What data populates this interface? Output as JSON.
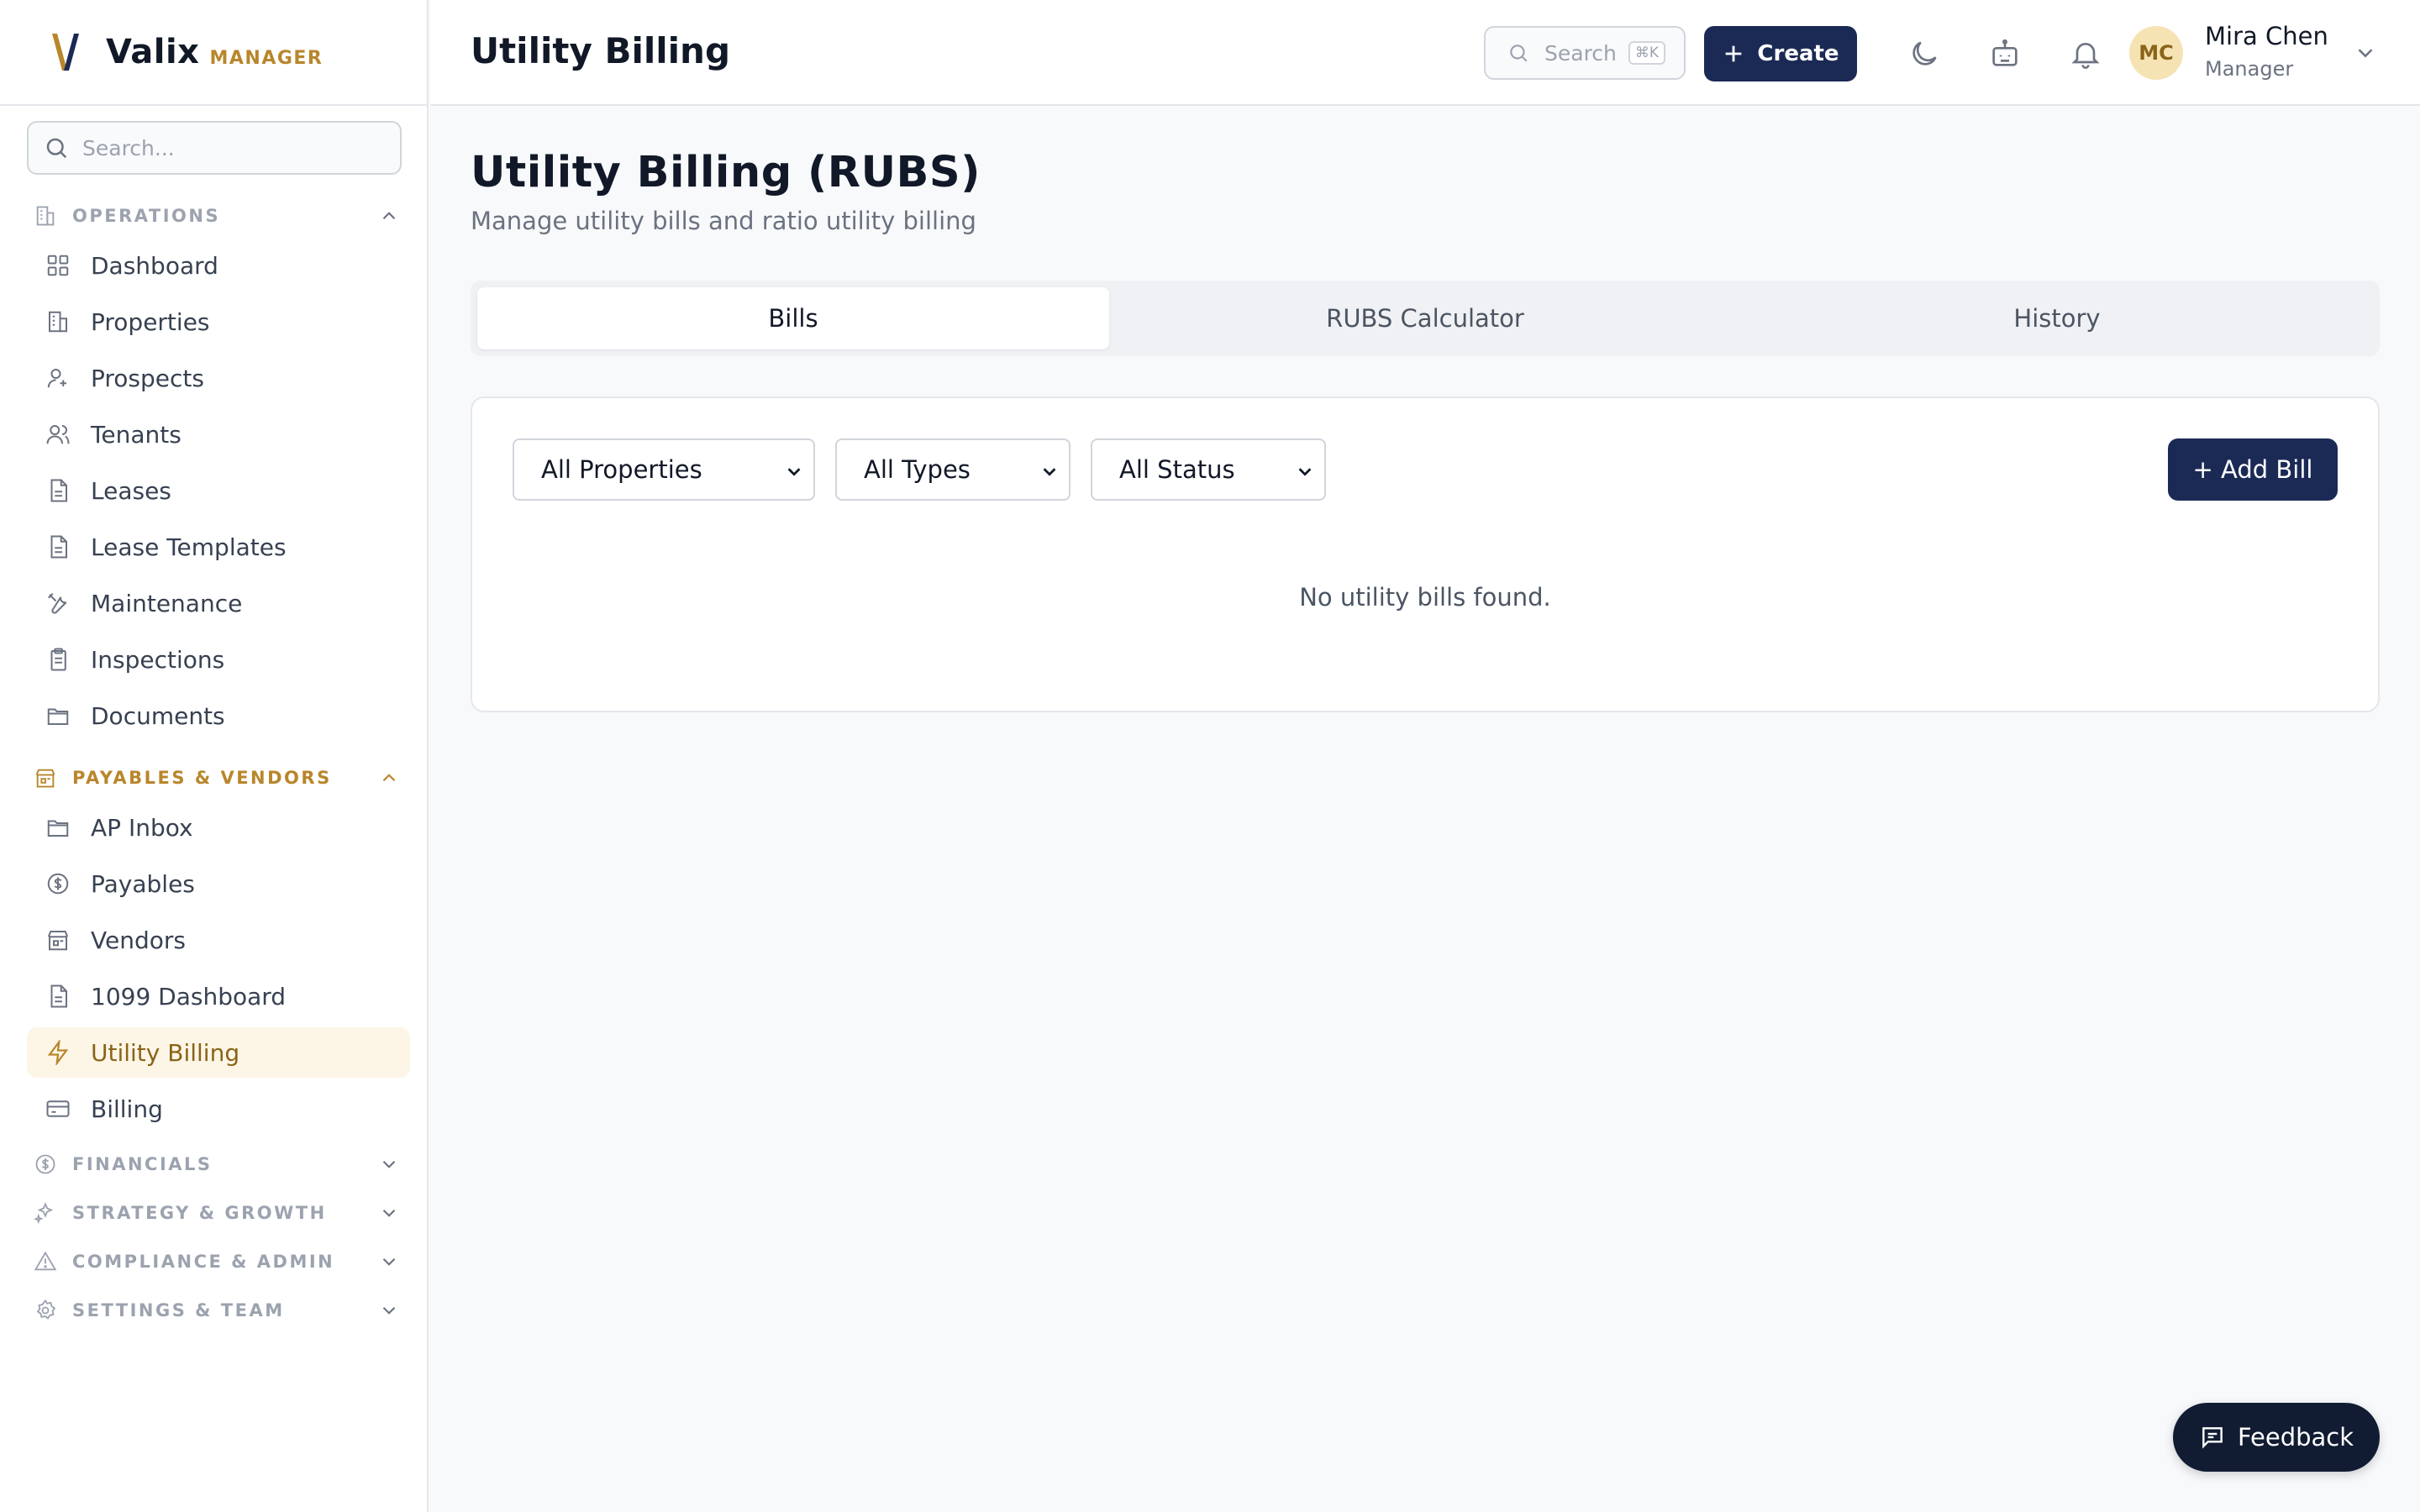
{
  "brand": {
    "name": "Valix",
    "sub": "MANAGER"
  },
  "sidebar": {
    "search_placeholder": "Search...",
    "sections": [
      {
        "label": "OPERATIONS",
        "icon": "building-icon",
        "expanded": true,
        "items": [
          {
            "label": "Dashboard",
            "icon": "grid-icon"
          },
          {
            "label": "Properties",
            "icon": "building-icon"
          },
          {
            "label": "Prospects",
            "icon": "user-plus-icon"
          },
          {
            "label": "Tenants",
            "icon": "users-icon"
          },
          {
            "label": "Leases",
            "icon": "file-icon"
          },
          {
            "label": "Lease Templates",
            "icon": "file-icon"
          },
          {
            "label": "Maintenance",
            "icon": "wrench-icon"
          },
          {
            "label": "Inspections",
            "icon": "clipboard-icon"
          },
          {
            "label": "Documents",
            "icon": "folder-icon"
          }
        ]
      },
      {
        "label": "PAYABLES & VENDORS",
        "icon": "store-icon",
        "expanded": true,
        "items": [
          {
            "label": "AP Inbox",
            "icon": "folder-icon"
          },
          {
            "label": "Payables",
            "icon": "dollar-circle-icon"
          },
          {
            "label": "Vendors",
            "icon": "store-icon"
          },
          {
            "label": "1099 Dashboard",
            "icon": "file-icon"
          },
          {
            "label": "Utility Billing",
            "icon": "zap-icon",
            "active": true
          },
          {
            "label": "Billing",
            "icon": "credit-card-icon"
          }
        ]
      },
      {
        "label": "FINANCIALS",
        "icon": "dollar-circle-icon",
        "expanded": false
      },
      {
        "label": "STRATEGY & GROWTH",
        "icon": "sparkles-icon",
        "expanded": false
      },
      {
        "label": "COMPLIANCE & ADMIN",
        "icon": "alert-triangle-icon",
        "expanded": false
      },
      {
        "label": "SETTINGS & TEAM",
        "icon": "gear-icon",
        "expanded": false
      }
    ]
  },
  "header": {
    "title": "Utility Billing",
    "search_label": "Search",
    "search_shortcut": "⌘K",
    "create_label": "Create",
    "user": {
      "initials": "MC",
      "name": "Mira Chen",
      "role": "Manager"
    }
  },
  "main": {
    "title": "Utility Billing (RUBS)",
    "subtitle": "Manage utility bills and ratio utility billing",
    "tabs": [
      {
        "label": "Bills",
        "active": true
      },
      {
        "label": "RUBS Calculator"
      },
      {
        "label": "History"
      }
    ],
    "filters": {
      "property": "All Properties",
      "type": "All Types",
      "status": "All Status"
    },
    "add_bill_label": "+ Add Bill",
    "empty_message": "No utility bills found."
  },
  "feedback_label": "Feedback",
  "colors": {
    "accent": "#b8862b",
    "primary": "#1b2a55",
    "active_bg": "#fdf6e7"
  }
}
